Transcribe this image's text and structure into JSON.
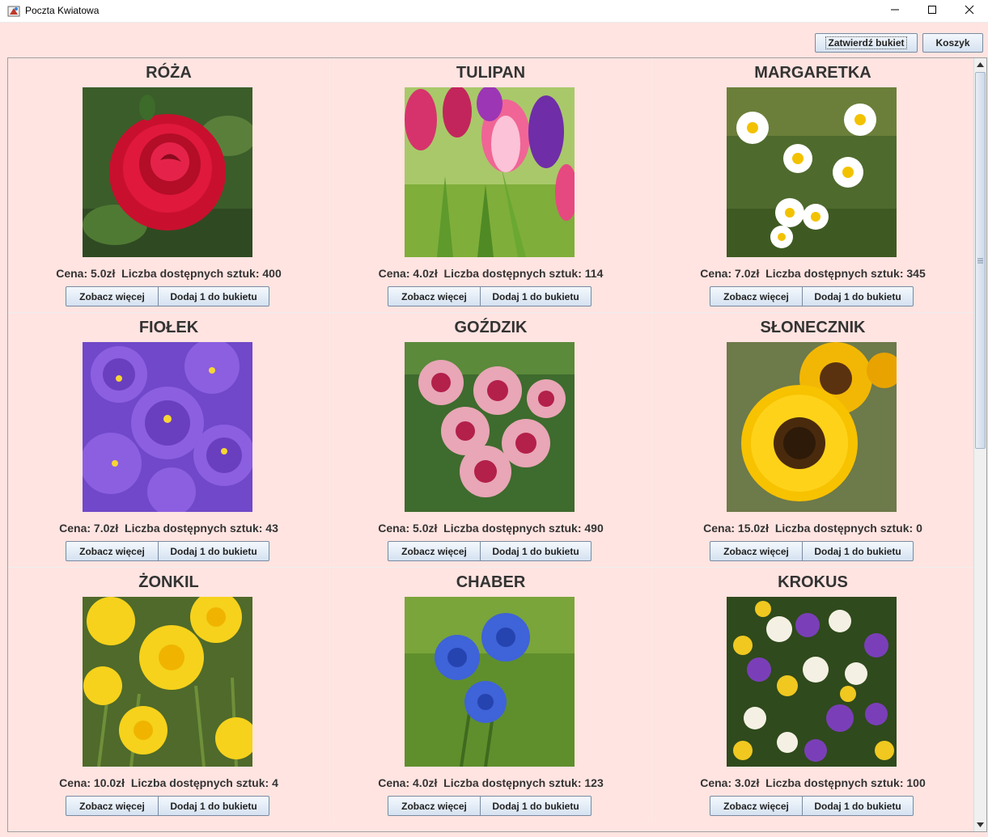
{
  "window": {
    "title": "Poczta Kwiatowa"
  },
  "toolbar": {
    "confirm_label": "Zatwierdź bukiet",
    "cart_label": "Koszyk"
  },
  "products": [
    {
      "name": "RÓŻA",
      "info": "Cena: 5.0zł  Liczba dostępnych sztuk: 400",
      "more_label": "Zobacz więcej",
      "add_label": "Dodaj 1 do bukietu"
    },
    {
      "name": "TULIPAN",
      "info": "Cena: 4.0zł  Liczba dostępnych sztuk: 114",
      "more_label": "Zobacz więcej",
      "add_label": "Dodaj 1 do bukietu"
    },
    {
      "name": "MARGARETKA",
      "info": "Cena: 7.0zł  Liczba dostępnych sztuk: 345",
      "more_label": "Zobacz więcej",
      "add_label": "Dodaj 1 do bukietu"
    },
    {
      "name": "FIOŁEK",
      "info": "Cena: 7.0zł  Liczba dostępnych sztuk: 43",
      "more_label": "Zobacz więcej",
      "add_label": "Dodaj 1 do bukietu"
    },
    {
      "name": "GOŹDZIK",
      "info": "Cena: 5.0zł  Liczba dostępnych sztuk: 490",
      "more_label": "Zobacz więcej",
      "add_label": "Dodaj 1 do bukietu"
    },
    {
      "name": "SŁONECZNIK",
      "info": "Cena: 15.0zł  Liczba dostępnych sztuk: 0",
      "more_label": "Zobacz więcej",
      "add_label": "Dodaj 1 do bukietu"
    },
    {
      "name": "ŻONKIL",
      "info": "Cena: 10.0zł  Liczba dostępnych sztuk: 4",
      "more_label": "Zobacz więcej",
      "add_label": "Dodaj 1 do bukietu"
    },
    {
      "name": "CHABER",
      "info": "Cena: 4.0zł  Liczba dostępnych sztuk: 123",
      "more_label": "Zobacz więcej",
      "add_label": "Dodaj 1 do bukietu"
    },
    {
      "name": "KROKUS",
      "info": "Cena: 3.0zł  Liczba dostępnych sztuk: 100",
      "more_label": "Zobacz więcej",
      "add_label": "Dodaj 1 do bukietu"
    }
  ],
  "icons": {
    "app": "java-app-icon",
    "minimize": "minimize-icon",
    "maximize": "maximize-icon",
    "close": "close-icon"
  },
  "colors": {
    "background": "#ffe4e1",
    "button_top": "#f4f8fd",
    "button_bottom": "#d5e2f1"
  }
}
